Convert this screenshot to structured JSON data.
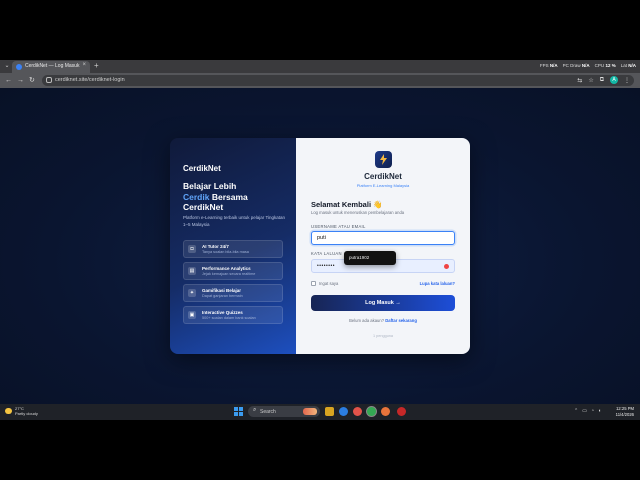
{
  "browser": {
    "tab_title": "CerdikNet — Log Masuk",
    "url": "cerdiknet.site/cerdiknet-login",
    "stats": [
      {
        "label": "FPS",
        "value": "N/A"
      },
      {
        "label": "PC Draw",
        "value": "N/A"
      },
      {
        "label": "CPU",
        "value": "12 %"
      },
      {
        "label": "Lat",
        "value": "N/A"
      }
    ],
    "profile_initial": "A"
  },
  "left_panel": {
    "brand": "CerdikNet",
    "headline_line1": "Belajar Lebih",
    "headline_highlight": "Cerdik",
    "headline_line2_rest": " Bersama",
    "headline_line3": "CerdikNet",
    "subtitle": "Platform e-Learning terbaik untuk pelajar Tingkatan 1–5 Malaysia",
    "features": [
      {
        "icon": "robot-icon",
        "glyph": "◘",
        "title": "AI Tutor 24/7",
        "sub": "Tanya soalan bila-bila masa"
      },
      {
        "icon": "chart-icon",
        "glyph": "▤",
        "title": "Performance Analytics",
        "sub": "Jejak kemajuan secara realtime"
      },
      {
        "icon": "trophy-icon",
        "glyph": "✦",
        "title": "Gamifikasi Belajar",
        "sub": "Dapat ganjaran bermain"
      },
      {
        "icon": "quiz-icon",
        "glyph": "▣",
        "title": "Interactive Quizzes",
        "sub": "500+ soalan dalam bank soalan"
      }
    ]
  },
  "right_panel": {
    "brand": "CerdikNet",
    "tagline": "Platform E-Learning Malaysia",
    "welcome": "Selamat Kembali",
    "welcome_emoji": "👋",
    "welcome_sub": "Log masuk untuk meneruskan pembelajaran anda",
    "username_label": "USERNAME ATAU EMAIL",
    "username_value": "puti",
    "autocomplete_suggestion": "putra1902",
    "password_label": "KATA LALUAN",
    "password_masked": "••••••••",
    "remember_label": "Ingat saya",
    "forgot_label": "Lupa kata laluan?",
    "login_button": "Log Masuk →",
    "signup_prompt": "Belum ada akaun?",
    "signup_link": "Daftar sekarang",
    "users_note": "1 pengguna"
  },
  "taskbar": {
    "weather_temp": "27°C",
    "weather_desc": "Partly cloudy",
    "search_label": "Search",
    "time": "12:25 PM",
    "date": "11/4/2026"
  },
  "colors": {
    "accent": "#3b82f6",
    "page_bg": "#0a1530",
    "button_start": "#172554",
    "button_end": "#1d4ed8"
  }
}
